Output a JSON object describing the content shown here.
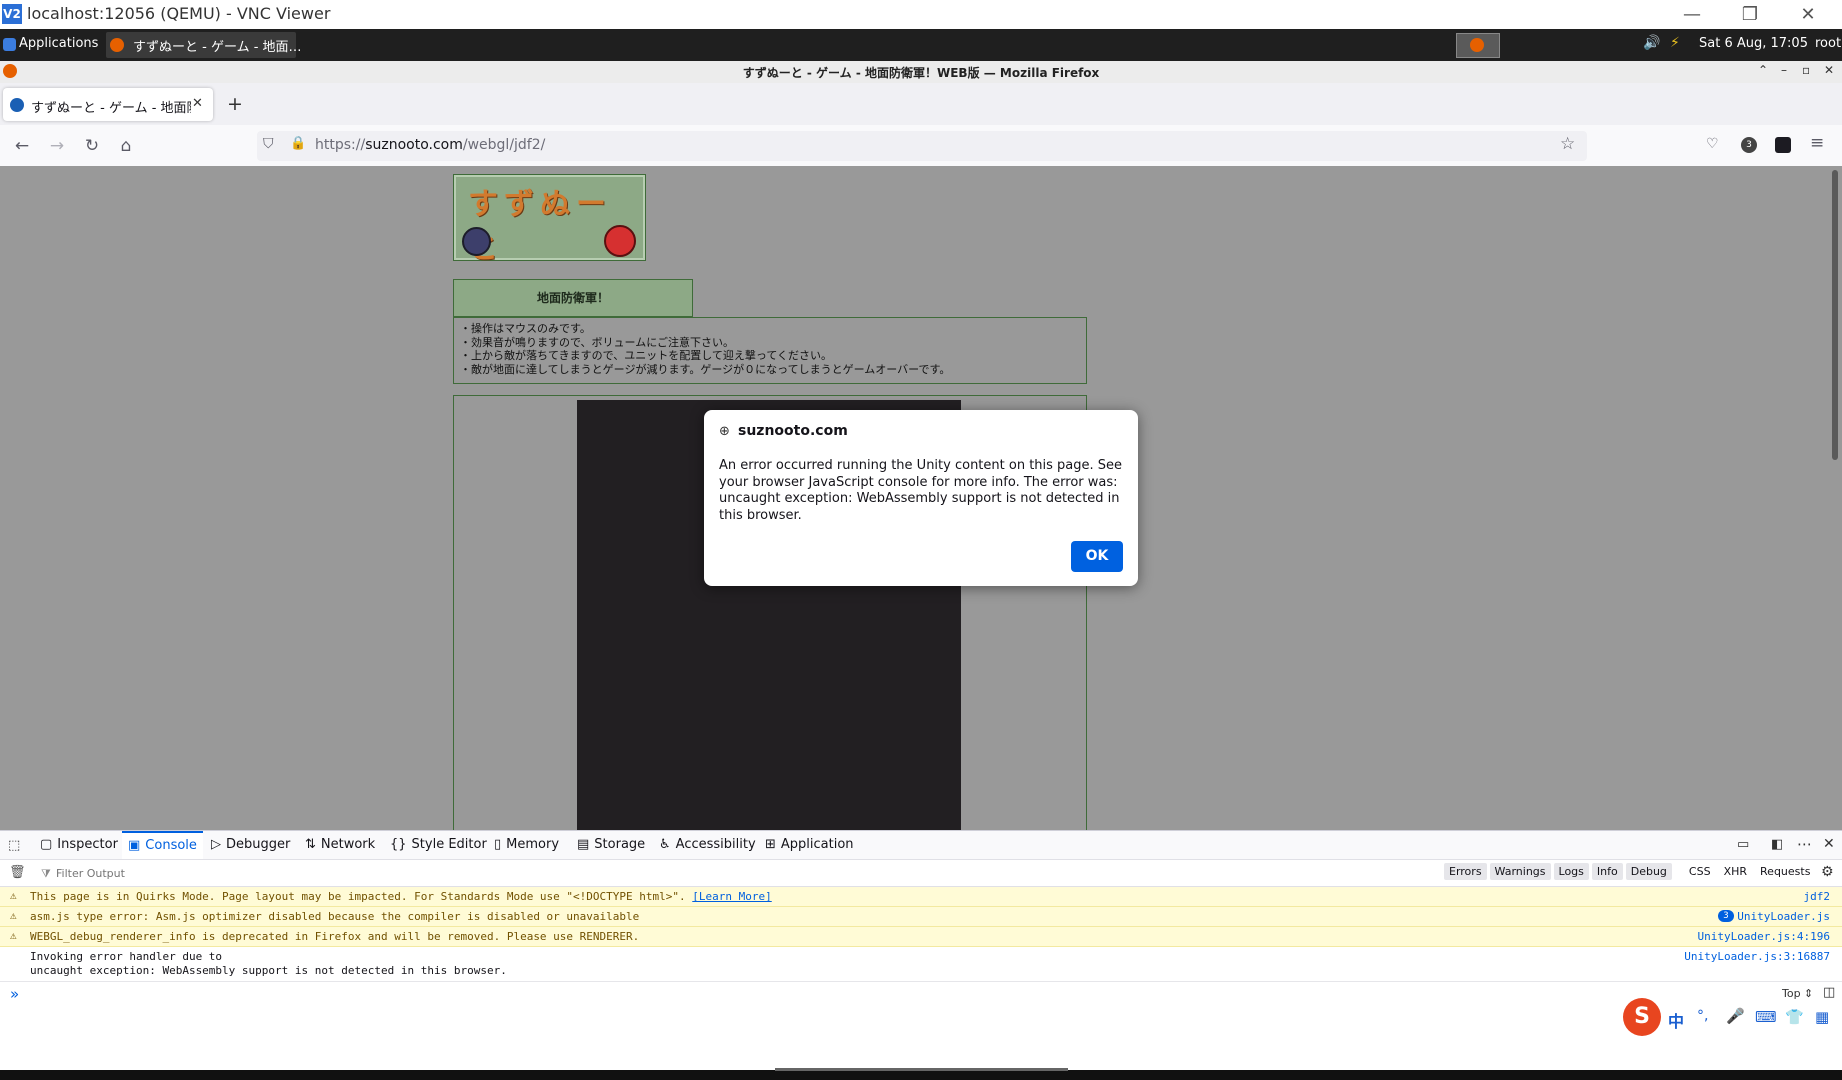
{
  "vnc": {
    "title": "localhost:12056 (QEMU) - VNC Viewer",
    "logo": "V2"
  },
  "panel": {
    "applications": "Applications",
    "task_title": "すずぬーと - ゲーム - 地面…",
    "clock": "Sat  6 Aug, 17:05",
    "user": "root"
  },
  "firefox": {
    "window_title": "すずぬーと - ゲーム - 地面防衛軍！WEB版 — Mozilla Firefox",
    "tab_title": "すずぬーと - ゲーム - 地面防",
    "url_prefix": "https://",
    "url_domain": "suznooto.com",
    "url_path": "/webgl/jdf2/",
    "ext_badge": "3"
  },
  "page": {
    "logo_text": "すずぬーと",
    "game_title": "地面防衛軍！",
    "instructions": [
      "・操作はマウスのみです。",
      "・効果音が鳴りますので、ボリュームにご注意下さい。",
      "・上から敵が落ちてきますので、ユニットを配置して迎え撃ってください。",
      "・敵が地面に達してしまうとゲージが減ります。ゲージが０になってしまうとゲームオーバーです。"
    ]
  },
  "dialog": {
    "origin": "suznooto.com",
    "message": "An error occurred running the Unity content on this page. See your browser JavaScript console for more info. The error was: uncaught exception: WebAssembly support is not detected in this browser.",
    "ok_label": "OK"
  },
  "devtools": {
    "tabs": [
      "Inspector",
      "Console",
      "Debugger",
      "Network",
      "Style Editor",
      "Memory",
      "Storage",
      "Accessibility",
      "Application"
    ],
    "active_tab": "Console",
    "filter_placeholder": "Filter Output",
    "filters": [
      "Errors",
      "Warnings",
      "Logs",
      "Info",
      "Debug",
      "CSS",
      "XHR",
      "Requests"
    ],
    "logs": [
      {
        "type": "warning",
        "text": "This page is in Quirks Mode. Page layout may be impacted. For Standards Mode use \"<!DOCTYPE html>\".",
        "link": "[Learn More]",
        "source": "jdf2"
      },
      {
        "type": "warning",
        "text": "asm.js type error: Asm.js optimizer disabled because the compiler is disabled or unavailable",
        "count": "3",
        "source": "UnityLoader.js"
      },
      {
        "type": "warning",
        "text": "WEBGL_debug_renderer_info is deprecated in Firefox and will be removed. Please use RENDERER.",
        "source": "UnityLoader.js:4:196"
      },
      {
        "type": "log",
        "text_line1": "Invoking error handler due to",
        "text_line2": "uncaught exception: WebAssembly support is not detected in this browser.",
        "source": "UnityLoader.js:3:16887"
      }
    ],
    "prompt": "»",
    "context": "Top ⇕"
  },
  "ime": {
    "label": "中"
  },
  "colors": {
    "accent": "#0060df",
    "page_bg": "#999999",
    "green_panel": "#8da986",
    "canvas": "#221f22"
  }
}
